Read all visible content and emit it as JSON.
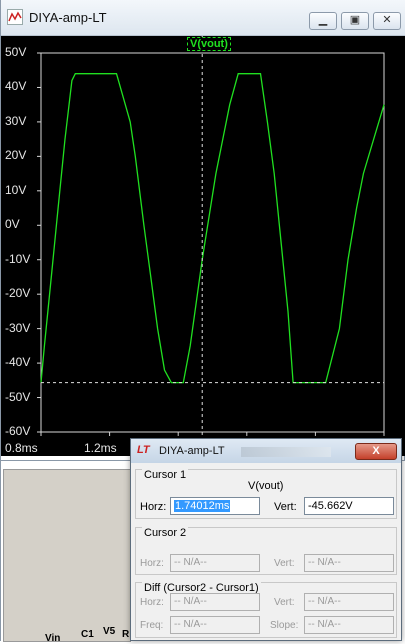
{
  "window": {
    "title": "DIYA-amp-LT",
    "buttons": [
      "▁",
      "▣",
      "✕"
    ]
  },
  "plot": {
    "trace_label": "V(vout)",
    "y_ticks": [
      "50V",
      "40V",
      "30V",
      "20V",
      "10V",
      "0V",
      "-10V",
      "-20V",
      "-30V",
      "-40V",
      "-50V",
      "-60V"
    ],
    "x_ticks": [
      "0.8ms",
      "1.2ms"
    ]
  },
  "chart_data": {
    "type": "line",
    "title": "",
    "ylabel": "",
    "xlabel": "",
    "ylim": [
      -60,
      50
    ],
    "xlim": [
      0.8,
      2.8
    ],
    "grid": true,
    "series": [
      {
        "name": "V(vout)",
        "color": "#20e020",
        "x": [
          0.8,
          0.82,
          0.86,
          0.9,
          0.94,
          0.98,
          1.0,
          1.08,
          1.16,
          1.24,
          1.32,
          1.35,
          1.4,
          1.44,
          1.48,
          1.52,
          1.56,
          1.6,
          1.63,
          1.67,
          1.74,
          1.82,
          1.9,
          1.95,
          2.0,
          2.04,
          2.08,
          2.12,
          2.16,
          2.2,
          2.24,
          2.27,
          2.31,
          2.38,
          2.46,
          2.54,
          2.59,
          2.64,
          2.68,
          2.74,
          2.8
        ],
        "y": [
          -45.66,
          -35,
          -15,
          5,
          25,
          42,
          44,
          44,
          44,
          44,
          30,
          20,
          0,
          -15,
          -30,
          -42,
          -45.66,
          -45.66,
          -45.66,
          -35,
          -10,
          15,
          35,
          44,
          44,
          44,
          44,
          30,
          15,
          -5,
          -25,
          -45.66,
          -45.66,
          -45.66,
          -45.66,
          -30,
          -10,
          5,
          15,
          25,
          35
        ]
      }
    ],
    "cursor": {
      "x": 1.74,
      "y": -45.662
    }
  },
  "schematic": {
    "labels": [
      "Vin",
      "C1",
      "V5",
      "R"
    ]
  },
  "cursor_dialog": {
    "title": "DIYA-amp-LT",
    "close": "X",
    "cursor1": {
      "heading": "Cursor 1",
      "trace": "V(vout)",
      "horz_label": "Horz:",
      "horz_value": "1.74012ms",
      "vert_label": "Vert:",
      "vert_value": "-45.662V"
    },
    "cursor2": {
      "heading": "Cursor 2",
      "horz_label": "Horz:",
      "horz_value": "-- N/A--",
      "vert_label": "Vert:",
      "vert_value": "-- N/A--"
    },
    "diff": {
      "heading": "Diff (Cursor2 - Cursor1)",
      "horz_label": "Horz:",
      "horz_value": "-- N/A--",
      "vert_label": "Vert:",
      "vert_value": "-- N/A--",
      "freq_label": "Freq:",
      "freq_value": "-- N/A--",
      "slope_label": "Slope:",
      "slope_value": "-- N/A--"
    }
  }
}
